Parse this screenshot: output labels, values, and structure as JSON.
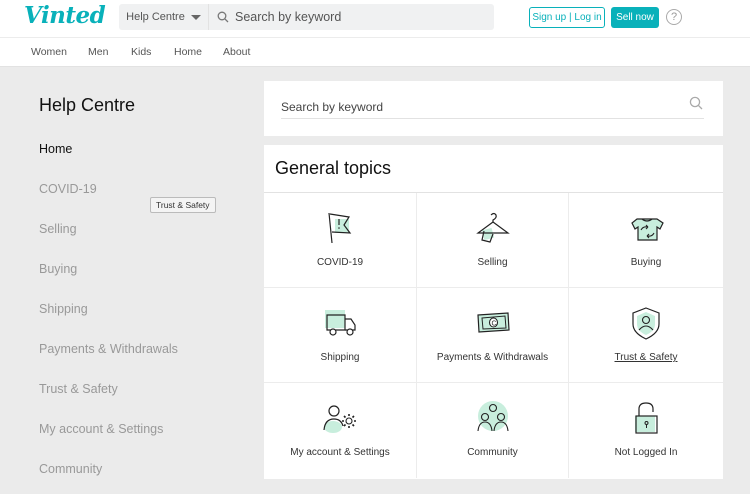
{
  "header": {
    "logo": "Vinted",
    "category_select": "Help Centre",
    "search_placeholder": "Search by keyword",
    "signup_login_label": "Sign up | Log in",
    "sell_now_label": "Sell now",
    "help_label": "?"
  },
  "nav": {
    "items": [
      "Women",
      "Men",
      "Kids",
      "Home",
      "About"
    ]
  },
  "sidebar": {
    "title": "Help Centre",
    "items": [
      {
        "label": "Home",
        "active": true
      },
      {
        "label": "COVID-19",
        "active": false
      },
      {
        "label": "Selling",
        "active": false
      },
      {
        "label": "Buying",
        "active": false
      },
      {
        "label": "Shipping",
        "active": false
      },
      {
        "label": "Payments & Withdrawals",
        "active": false
      },
      {
        "label": "Trust & Safety",
        "active": false
      },
      {
        "label": "My account & Settings",
        "active": false
      },
      {
        "label": "Community",
        "active": false
      }
    ],
    "tooltip": "Trust & Safety"
  },
  "main": {
    "search_placeholder": "Search by keyword",
    "topics_title": "General topics",
    "topics": [
      {
        "label": "COVID-19",
        "icon": "flag-icon"
      },
      {
        "label": "Selling",
        "icon": "hanger-tag-icon"
      },
      {
        "label": "Buying",
        "icon": "tshirt-exchange-icon"
      },
      {
        "label": "Shipping",
        "icon": "truck-icon"
      },
      {
        "label": "Payments & Withdrawals",
        "icon": "banknote-icon"
      },
      {
        "label": "Trust & Safety",
        "icon": "shield-user-icon"
      },
      {
        "label": "My account & Settings",
        "icon": "user-gear-icon"
      },
      {
        "label": "Community",
        "icon": "people-icon"
      },
      {
        "label": "Not Logged In",
        "icon": "padlock-icon"
      }
    ]
  },
  "colors": {
    "brand": "#09b1ba",
    "icon_fill": "#c8eedd",
    "background": "#ebebeb"
  }
}
